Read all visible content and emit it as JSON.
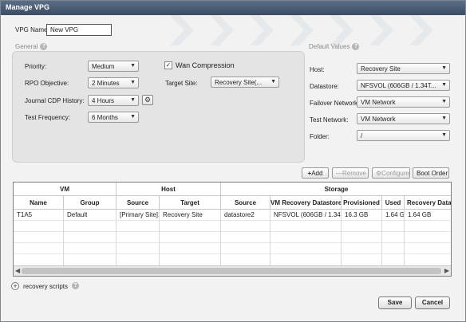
{
  "window": {
    "title": "Manage VPG"
  },
  "vpg": {
    "name_label": "VPG Name:",
    "name_value": "New VPG"
  },
  "general": {
    "heading": "General",
    "priority_label": "Priority:",
    "priority_value": "Medium",
    "rpo_label": "RPO Objective:",
    "rpo_value": "2 Minutes",
    "journal_label": "Journal CDP History:",
    "journal_value": "4 Hours",
    "test_freq_label": "Test Frequency:",
    "test_freq_value": "6 Months",
    "wan_label": "Wan Compression",
    "wan_checked": "✓",
    "target_site_label": "Target Site:",
    "target_site_value": "Recovery Site(..."
  },
  "defaults": {
    "heading": "Default Values",
    "host_label": "Host:",
    "host_value": "Recovery Site",
    "datastore_label": "Datastore:",
    "datastore_value": "NFSVOL (606GB / 1.34T...",
    "failover_label": "Failover Network:",
    "failover_value": "VM Network",
    "test_net_label": "Test Network:",
    "test_net_value": "VM Network",
    "folder_label": "Folder:",
    "folder_value": "/"
  },
  "toolbar": {
    "add": "Add",
    "remove": "Remove",
    "configure": "Configure",
    "boot_order": "Boot Order"
  },
  "table": {
    "groups": {
      "vm": "VM",
      "host": "Host",
      "storage": "Storage"
    },
    "columns": [
      "Name",
      "Group",
      "Source",
      "Target",
      "Source",
      "VM Recovery Datastore",
      "Provisioned",
      "Used",
      "Recovery Data Size"
    ],
    "rows": [
      [
        "T1A5",
        "Default",
        "[Primary Site]19...",
        "Recovery Site",
        "datastore2",
        "NFSVOL (606GB / 1.34TB Fr",
        "16.3 GB",
        "1.64 GB",
        "1.64 GB"
      ]
    ]
  },
  "footer": {
    "recovery_scripts": "recovery scripts",
    "save": "Save",
    "cancel": "Cancel"
  },
  "icons": {
    "help": "help-icon",
    "gear": "gear-icon",
    "plus": "plus-icon",
    "dropdown": "chevron-down-icon"
  }
}
